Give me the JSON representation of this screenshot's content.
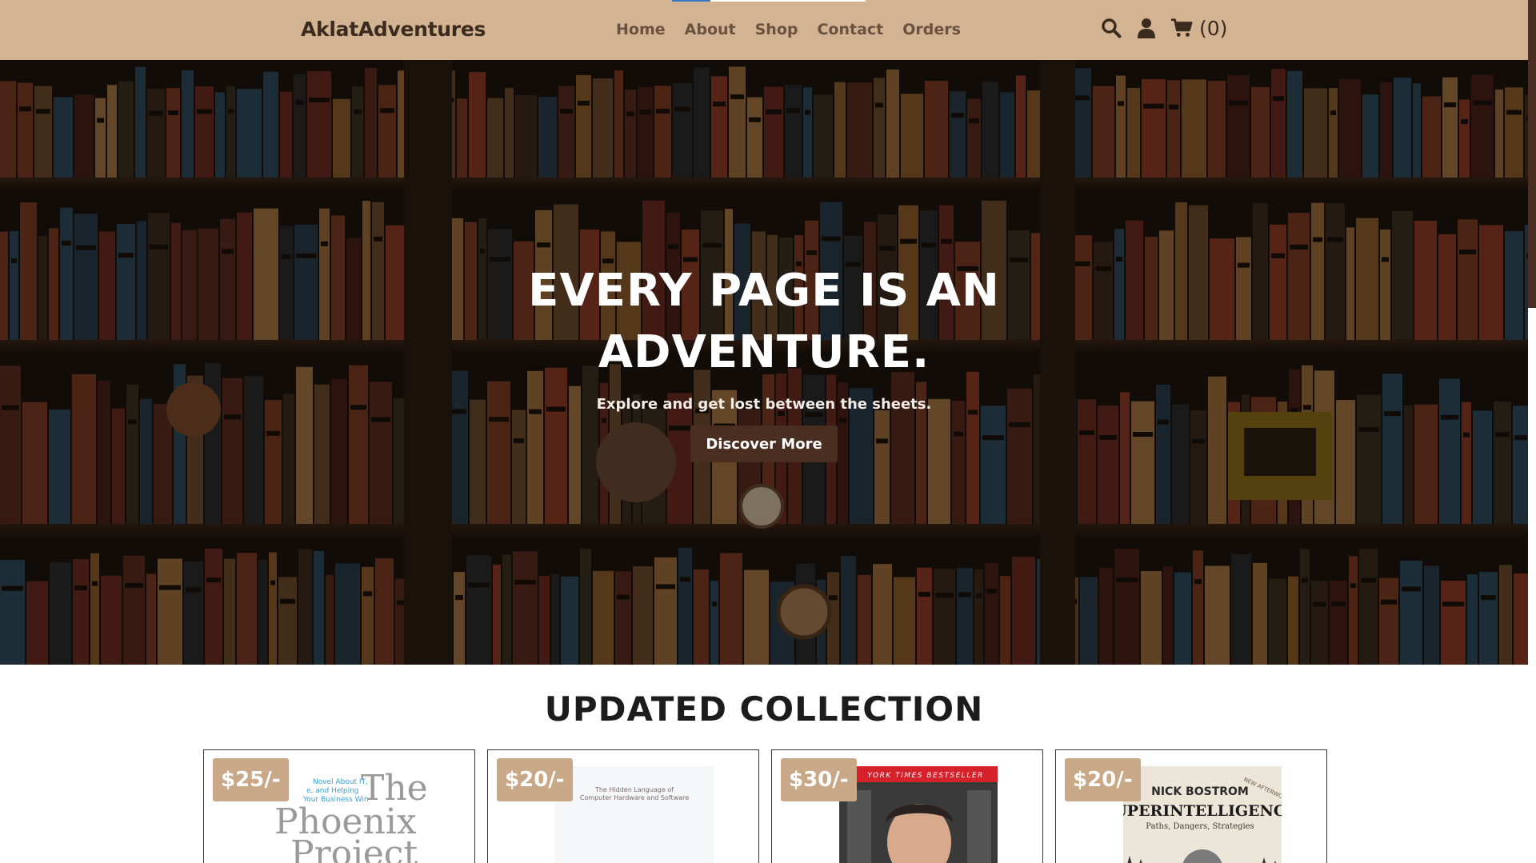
{
  "header": {
    "logo": "AklatAdventures",
    "nav": [
      "Home",
      "About",
      "Shop",
      "Contact",
      "Orders"
    ],
    "icons": [
      "search-icon",
      "user-icon",
      "cart-icon"
    ],
    "cart_count": "(0)",
    "background": "#d2b493"
  },
  "hero": {
    "title": "EVERY PAGE IS AN ADVENTURE.",
    "subtitle": "Explore and get lost between the sheets.",
    "button": "Discover More",
    "button_color": "#4a2e22"
  },
  "collection": {
    "title": "UPDATED COLLECTION",
    "price_badge_color": "#c9a887",
    "books": [
      {
        "price": "$25/-",
        "cover_lines": [
          "Novel About IT,",
          "e, and Helping",
          "Your Business Win",
          "The",
          "Phoenix",
          "Project"
        ]
      },
      {
        "price": "$20/-",
        "cover_lines": [
          "The Hidden Language of",
          "Computer Hardware and Software"
        ]
      },
      {
        "price": "$30/-",
        "cover_lines": [
          "YORK TIMES BESTSELLER"
        ]
      },
      {
        "price": "$20/-",
        "cover_lines": [
          "NEW AFTERWORD",
          "NICK BOSTROM",
          "SUPERINTELLIGENCE",
          "Paths, Dangers, Strategies"
        ]
      }
    ]
  }
}
